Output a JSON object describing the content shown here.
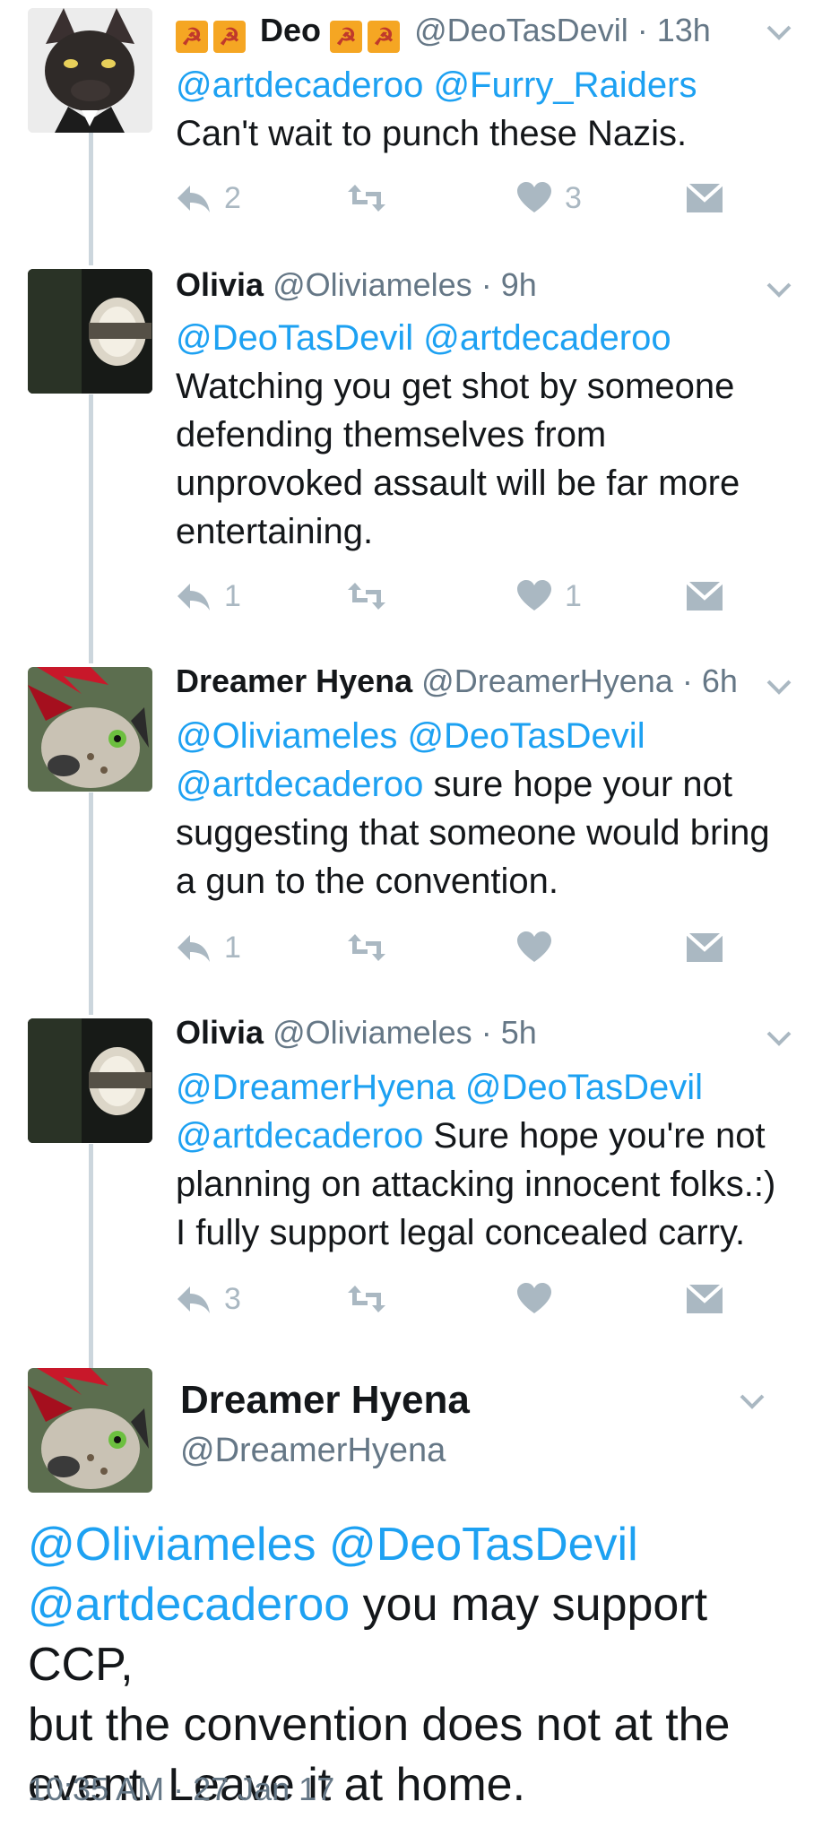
{
  "tweets": [
    {
      "name": "Deo",
      "flags": [
        "☭",
        "☭",
        "☭",
        "☭"
      ],
      "handle": "@DeoTasDevil",
      "time": "13h",
      "mentions": "@artdecaderoo @Furry_Raiders",
      "text": "Can't wait to punch these Nazis.",
      "replies": "2",
      "likes": "3"
    },
    {
      "name": "Olivia",
      "handle": "@Oliviameles",
      "time": "9h",
      "mentions": "@DeoTasDevil @artdecaderoo",
      "text_lines": [
        "Watching you get shot by someone",
        "defending themselves from",
        "unprovoked assault will be far more",
        "entertaining."
      ],
      "replies": "1",
      "likes": "1"
    },
    {
      "name": "Dreamer Hyena",
      "handle": "@DreamerHyena",
      "time": "6h",
      "mentions_line1": "@Oliviameles @DeoTasDevil",
      "mention_line2": "@artdecaderoo",
      "text_line2": " sure hope your not",
      "text_lines": [
        "suggesting that someone would bring",
        "a gun to the convention."
      ],
      "replies": "1"
    },
    {
      "name": "Olivia",
      "handle": "@Oliviameles",
      "time": "5h",
      "mentions_line1": "@DreamerHyena @DeoTasDevil",
      "mention_line2": "@artdecaderoo",
      "text_line2": " Sure hope you're not",
      "text_lines": [
        "planning on attacking innocent folks.:)",
        "I fully support legal concealed carry."
      ],
      "replies": "3"
    }
  ],
  "main_tweet": {
    "name": "Dreamer Hyena",
    "handle": "@DreamerHyena",
    "mentions_line1": "@Oliviameles @DeoTasDevil",
    "mention_line2": "@artdecaderoo",
    "text_line2": " you may support CCP,",
    "text_lines": [
      "but the convention does not at the",
      "event. Leave it at home."
    ],
    "timestamp": "10:35 AM · 27 Jan 17"
  },
  "separator": "·",
  "icons": {
    "reply": "reply-icon",
    "retweet": "retweet-icon",
    "like": "heart-icon",
    "dm": "envelope-icon",
    "more": "chevron-down-icon"
  },
  "colors": {
    "link": "#1da1f2",
    "muted": "#657786",
    "action": "#aab8c2",
    "thread": "#ccd6dd"
  }
}
